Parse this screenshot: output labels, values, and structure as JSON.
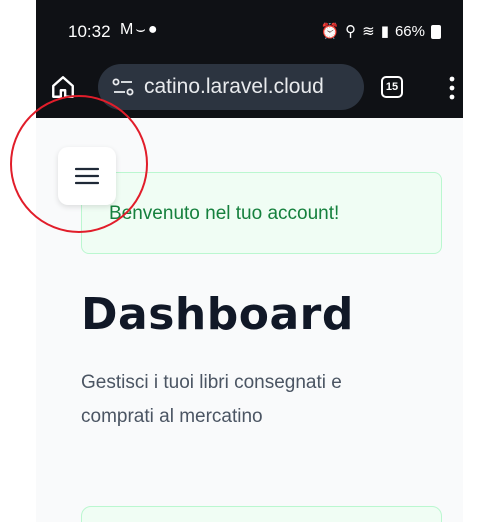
{
  "status_bar": {
    "time": "10:32",
    "left_icons": [
      "gmail-icon",
      "missed-call-icon",
      "chat-icon"
    ],
    "right_icons": [
      "alarm-icon",
      "location-icon",
      "wifi-icon",
      "signal-icon",
      "signal-icon"
    ],
    "battery": "66%"
  },
  "browser": {
    "url": "catino.laravel.cloud",
    "tab_count": "15"
  },
  "page": {
    "alert_message": "Benvenuto nel tuo account!",
    "title": "Dashboard",
    "subtitle": "Gestisci i tuoi libri consegnati e comprati al mercatino"
  },
  "colors": {
    "annotation": "#e11d2a",
    "alert_text": "#15803d",
    "alert_bg": "#f0fdf4"
  }
}
